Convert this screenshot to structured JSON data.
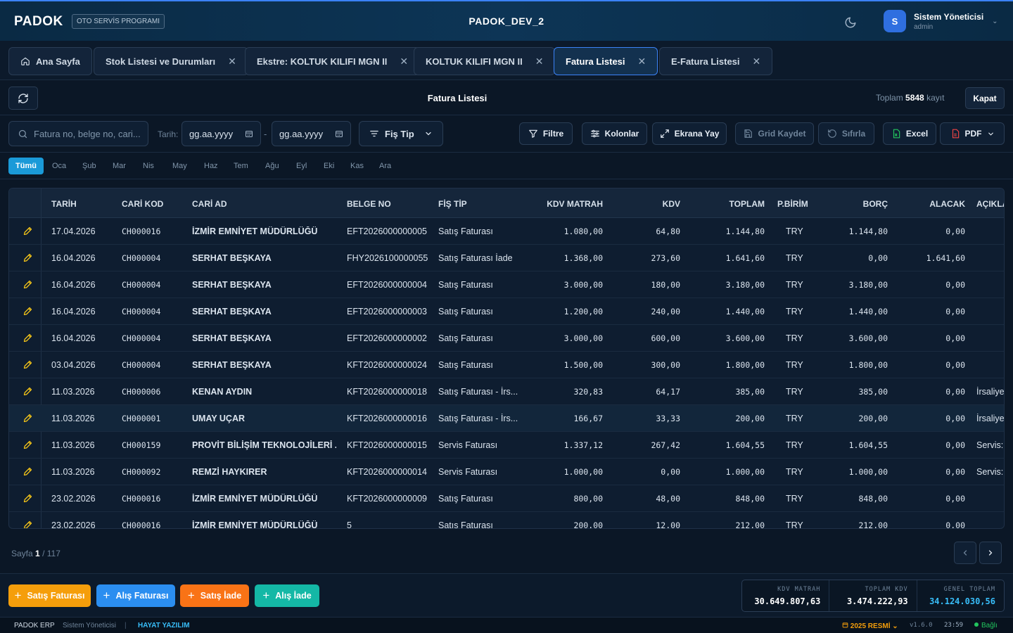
{
  "topbar": {
    "brand": "PADOK",
    "brand_tag": "OTO SERVİS PROGRAMI",
    "app_title": "PADOK_DEV_2",
    "user": {
      "initial": "S",
      "name": "Sistem Yöneticisi",
      "role": "admin"
    }
  },
  "tabs": [
    {
      "label": "Ana Sayfa"
    },
    {
      "label": "Stok Listesi ve Durumları"
    },
    {
      "label": "Ekstre: KOLTUK KILIFI MGN II"
    },
    {
      "label": "KOLTUK KILIFI MGN II"
    },
    {
      "label": "Fatura Listesi"
    },
    {
      "label": "E-Fatura Listesi"
    }
  ],
  "header": {
    "title": "Fatura Listesi",
    "total_prefix": "Toplam",
    "total_count": "5848",
    "total_suffix": "kayıt",
    "close_label": "Kapat"
  },
  "toolbar": {
    "search_placeholder": "Fatura no, belge no, cari...",
    "date_label": "Tarih:",
    "date_from": "gg.aa.yyyy",
    "dash": "-",
    "date_to": "gg.aa.yyyy",
    "fis_tip_label": "Fiş Tip",
    "filter_label": "Filtre",
    "columns_label": "Kolonlar",
    "fullscreen_label": "Ekrana Yay",
    "save_grid_label": "Grid Kaydet",
    "reset_label": "Sıfırla",
    "excel_label": "Excel",
    "pdf_label": "PDF"
  },
  "months": [
    "Tümü",
    "Oca",
    "Şub",
    "Mar",
    "Nis",
    "May",
    "Haz",
    "Tem",
    "Ağu",
    "Eyl",
    "Eki",
    "Kas",
    "Ara"
  ],
  "grid": {
    "columns": [
      "TARİH",
      "CARİ KOD",
      "CARİ AD",
      "BELGE NO",
      "FİŞ TİP",
      "KDV MATRAH",
      "KDV",
      "TOPLAM",
      "P.BİRİM",
      "BORÇ",
      "ALACAK",
      "AÇIKLA"
    ],
    "rows": [
      [
        "17.04.2026",
        "CH000016",
        "İZMİR EMNİYET MÜDÜRLÜĞÜ",
        "EFT2026000000005",
        "Satış Faturası",
        "1.080,00",
        "64,80",
        "1.144,80",
        "TRY",
        "1.144,80",
        "0,00",
        ""
      ],
      [
        "16.04.2026",
        "CH000004",
        "SERHAT BEŞKAYA",
        "FHY2026100000055",
        "Satış Faturası İade",
        "1.368,00",
        "273,60",
        "1.641,60",
        "TRY",
        "0,00",
        "1.641,60",
        ""
      ],
      [
        "16.04.2026",
        "CH000004",
        "SERHAT BEŞKAYA",
        "EFT2026000000004",
        "Satış Faturası",
        "3.000,00",
        "180,00",
        "3.180,00",
        "TRY",
        "3.180,00",
        "0,00",
        ""
      ],
      [
        "16.04.2026",
        "CH000004",
        "SERHAT BEŞKAYA",
        "EFT2026000000003",
        "Satış Faturası",
        "1.200,00",
        "240,00",
        "1.440,00",
        "TRY",
        "1.440,00",
        "0,00",
        ""
      ],
      [
        "16.04.2026",
        "CH000004",
        "SERHAT BEŞKAYA",
        "EFT2026000000002",
        "Satış Faturası",
        "3.000,00",
        "600,00",
        "3.600,00",
        "TRY",
        "3.600,00",
        "0,00",
        ""
      ],
      [
        "03.04.2026",
        "CH000004",
        "SERHAT BEŞKAYA",
        "KFT2026000000024",
        "Satış Faturası",
        "1.500,00",
        "300,00",
        "1.800,00",
        "TRY",
        "1.800,00",
        "0,00",
        ""
      ],
      [
        "11.03.2026",
        "CH000006",
        "KENAN AYDIN",
        "KFT2026000000018",
        "Satış Faturası - İrs...",
        "320,83",
        "64,17",
        "385,00",
        "TRY",
        "385,00",
        "0,00",
        "İrsaliye"
      ],
      [
        "11.03.2026",
        "CH000001",
        "UMAY UÇAR",
        "KFT2026000000016",
        "Satış Faturası - İrs...",
        "166,67",
        "33,33",
        "200,00",
        "TRY",
        "200,00",
        "0,00",
        "İrsaliye"
      ],
      [
        "11.03.2026",
        "CH000159",
        "PROVİT BİLİŞİM TEKNOLOJİLERİ ...",
        "KFT2026000000015",
        "Servis Faturası",
        "1.337,12",
        "267,42",
        "1.604,55",
        "TRY",
        "1.604,55",
        "0,00",
        "Servis:"
      ],
      [
        "11.03.2026",
        "CH000092",
        "REMZİ HAYKIRER",
        "KFT2026000000014",
        "Servis Faturası",
        "1.000,00",
        "0,00",
        "1.000,00",
        "TRY",
        "1.000,00",
        "0,00",
        "Servis:"
      ],
      [
        "23.02.2026",
        "CH000016",
        "İZMİR EMNİYET MÜDÜRLÜĞÜ",
        "KFT2026000000009",
        "Satış Faturası",
        "800,00",
        "48,00",
        "848,00",
        "TRY",
        "848,00",
        "0,00",
        ""
      ],
      [
        "23.02.2026",
        "CH000016",
        "İZMİR EMNİYET MÜDÜRLÜĞÜ",
        "5",
        "Satış Faturası",
        "200,00",
        "12,00",
        "212,00",
        "TRY",
        "212,00",
        "0,00",
        ""
      ]
    ]
  },
  "pager": {
    "label": "Sayfa",
    "current": "1",
    "total": "/ 117"
  },
  "actions": [
    {
      "label": "Satış Faturası",
      "color": "#f59e0b"
    },
    {
      "label": "Alış Faturası",
      "color": "#2b8ef0"
    },
    {
      "label": "Satış İade",
      "color": "#f97316"
    },
    {
      "label": "Alış İade",
      "color": "#14b8a6"
    }
  ],
  "summary": {
    "kdv_matrah_label": "KDV MATRAH",
    "kdv_matrah": "30.649.807,63",
    "toplam_kdv_label": "TOPLAM KDV",
    "toplam_kdv": "3.474.222,93",
    "genel_toplam_label": "GENEL TOPLAM",
    "genel_toplam": "34.124.030,56"
  },
  "status": {
    "app": "PADOK ERP",
    "user": "Sistem Yöneticisi",
    "sep": "|",
    "company": "HAYAT YAZILIM",
    "period": "2025 RESMİ",
    "version": "v1.6.0",
    "time": "23:59",
    "connection": "Bağlı"
  }
}
